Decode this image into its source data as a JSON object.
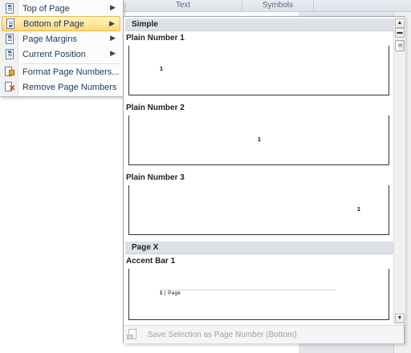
{
  "ribbon": {
    "group_text": "Text",
    "group_symbols": "Symbols"
  },
  "menu": {
    "items": [
      {
        "label": "Top of Page",
        "icon": "page-top-icon",
        "has_submenu": true
      },
      {
        "label": "Bottom of Page",
        "icon": "page-bottom-icon",
        "has_submenu": true,
        "active": true
      },
      {
        "label": "Page Margins",
        "icon": "page-margins-icon",
        "has_submenu": true
      },
      {
        "label": "Current Position",
        "icon": "current-position-icon",
        "has_submenu": true
      },
      {
        "label": "Format Page Numbers...",
        "icon": "format-page-numbers-icon",
        "has_submenu": false
      },
      {
        "label": "Remove Page Numbers",
        "icon": "remove-page-numbers-icon",
        "has_submenu": false
      }
    ],
    "submenu_arrow": "▶"
  },
  "gallery": {
    "categories": [
      {
        "name": "Simple"
      },
      {
        "name": "Page X"
      }
    ],
    "items": [
      {
        "title": "Plain Number 1",
        "sample": "1"
      },
      {
        "title": "Plain Number 2",
        "sample": "1"
      },
      {
        "title": "Plain Number 3",
        "sample": "1"
      },
      {
        "title": "Accent Bar 1",
        "sample_number": "1",
        "sample_sep": " | ",
        "sample_word": "Page"
      }
    ],
    "footer_label": "Save Selection as Page Number (Bottom)",
    "scroll_up": "▲",
    "scroll_down": "▼"
  },
  "colors": {
    "menu_highlight": "#ffd979",
    "category_header": "#dde1e7",
    "disabled_text": "#a0a0a0"
  }
}
